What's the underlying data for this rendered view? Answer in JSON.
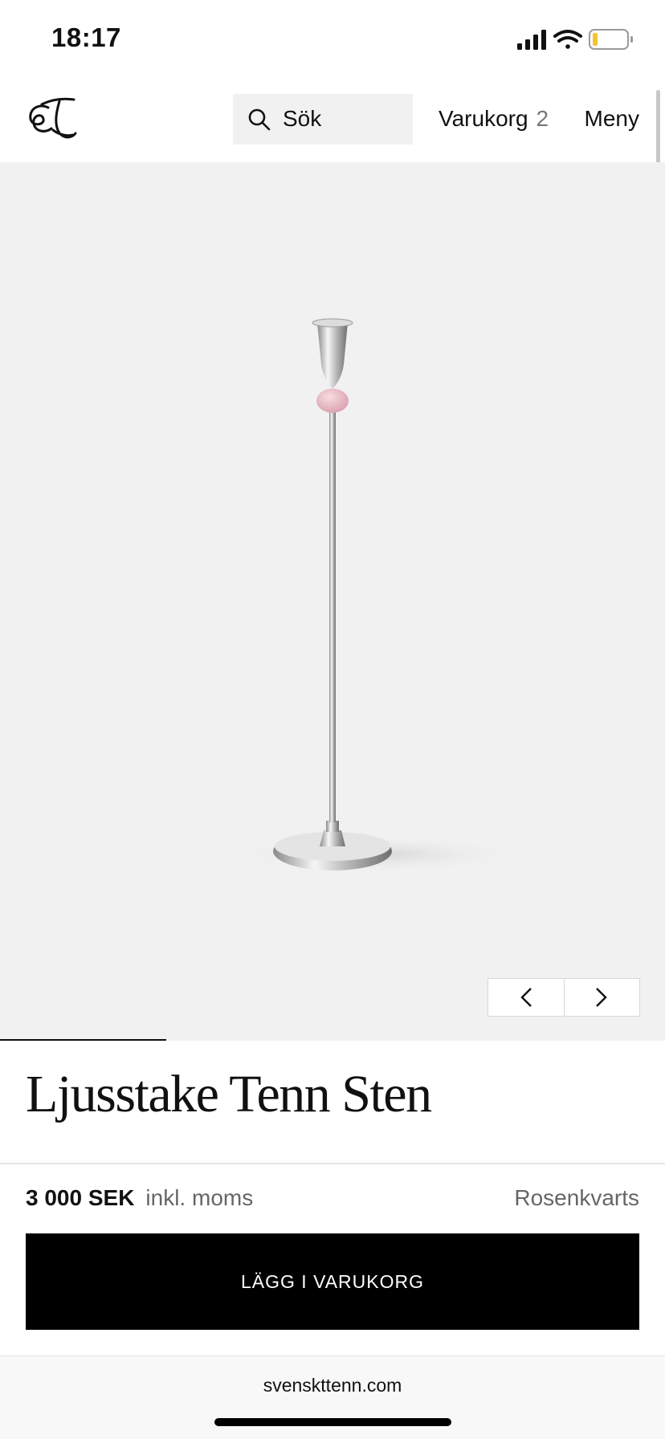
{
  "status_bar": {
    "time": "18:17",
    "battery_level": 0.15
  },
  "header": {
    "logo_icon": "svenskt-tenn-monogram",
    "search_label": "Sök",
    "cart_label": "Varukorg",
    "cart_count": "2",
    "menu_label": "Meny"
  },
  "gallery": {
    "prev_icon": "chevron-left-icon",
    "next_icon": "chevron-right-icon",
    "progress": 0.25
  },
  "product": {
    "title": "Ljusstake Tenn Sten",
    "price": "3 000 SEK",
    "vat_note": "inkl. moms",
    "variant": "Rosenkvarts",
    "add_to_cart_label": "LÄGG I VARUKORG"
  },
  "browser": {
    "url": "svenskttenn.com"
  },
  "colors": {
    "gallery_bg": "#f1f1f1",
    "cta_bg": "#000000",
    "stone": "#e8b7c0"
  }
}
